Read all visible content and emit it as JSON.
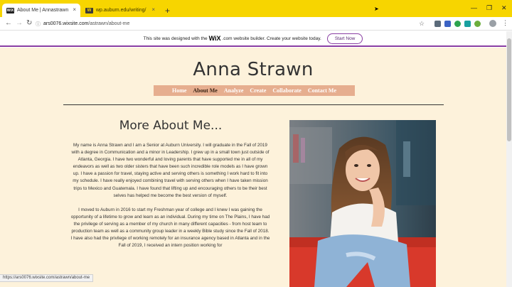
{
  "browser": {
    "tabs": [
      {
        "favicon": "WiX",
        "title": "About Me | Annastrawn",
        "close": "×"
      },
      {
        "favicon": "W",
        "title": "wp.auburn.edu/writing/",
        "close": "×"
      }
    ],
    "new_tab": "+",
    "window_controls": {
      "minimize": "—",
      "restore": "❐",
      "close": "✕"
    },
    "nav": {
      "back": "←",
      "forward": "→",
      "reload": "↻"
    },
    "url_lock": "ⓘ",
    "url_host": "ars0076.wixsite.com",
    "url_path": "/astrawn/about-me",
    "bookmark_star": "☆",
    "menu_dots": "⋮",
    "status_url": "https://ars0076.wixsite.com/astrawn/about-me"
  },
  "wix_banner": {
    "text_before": "This site was designed with the",
    "logo": "WiX",
    "text_after": ".com website builder. Create your website today.",
    "button": "Start Now"
  },
  "site": {
    "title": "Anna Strawn",
    "menu": [
      "Home",
      "About Me",
      "Analyze",
      "Create",
      "Collaborate",
      "Contact Me"
    ],
    "section_title": "More About Me...",
    "paragraphs": [
      "My name is Anna Strawn and I am a Senior at Auburn University. I will graduate in the Fall of 2019 with a degree in Communication and a minor in Leadership. I grew up in a small town just outside of Atlanta, Georgia. I have two wonderful and loving parents that have supported me in all of my endeavors as well as two older sisters that have been such incredible role models as I have grown up. I have a passion for travel, staying active and serving others is something I work hard to fit into my schedule. I have really enjoyed combining travel with serving others when I have taken mission trips to Mexico and Guatemala. I have found that lifting up and encouraging others to be their best selves has helped me become the best version of myself.",
      "I moved to Auburn in 2016 to start my Freshman year of college and I knew I was gaining the opportunity of a lifetime to grow and learn as an individual. During my time on The Plains, I have had the privilege of serving as a member of my church in many different capacities - from host team to production team as well as a community group leader in a weekly Bible study since the Fall of 2018. I have also had the privilege of working remotely for an insurance agency based in Atlanta and in the Fall of 2019, I received an intern position working for"
    ]
  },
  "colors": {
    "tab_strip": "#f7d500",
    "page_background": "#fdf2db",
    "menu_background": "#e6ae8f",
    "wix_accent": "#8a3ea3"
  }
}
